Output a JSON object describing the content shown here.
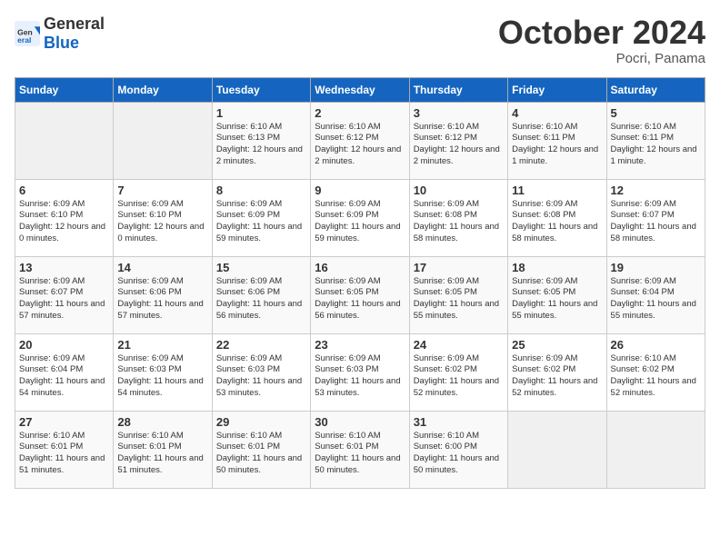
{
  "header": {
    "logo_general": "General",
    "logo_blue": "Blue",
    "month": "October 2024",
    "location": "Pocri, Panama"
  },
  "weekdays": [
    "Sunday",
    "Monday",
    "Tuesday",
    "Wednesday",
    "Thursday",
    "Friday",
    "Saturday"
  ],
  "weeks": [
    [
      {
        "day": "",
        "empty": true
      },
      {
        "day": "",
        "empty": true
      },
      {
        "day": "1",
        "sunrise": "Sunrise: 6:10 AM",
        "sunset": "Sunset: 6:13 PM",
        "daylight": "Daylight: 12 hours and 2 minutes."
      },
      {
        "day": "2",
        "sunrise": "Sunrise: 6:10 AM",
        "sunset": "Sunset: 6:12 PM",
        "daylight": "Daylight: 12 hours and 2 minutes."
      },
      {
        "day": "3",
        "sunrise": "Sunrise: 6:10 AM",
        "sunset": "Sunset: 6:12 PM",
        "daylight": "Daylight: 12 hours and 2 minutes."
      },
      {
        "day": "4",
        "sunrise": "Sunrise: 6:10 AM",
        "sunset": "Sunset: 6:11 PM",
        "daylight": "Daylight: 12 hours and 1 minute."
      },
      {
        "day": "5",
        "sunrise": "Sunrise: 6:10 AM",
        "sunset": "Sunset: 6:11 PM",
        "daylight": "Daylight: 12 hours and 1 minute."
      }
    ],
    [
      {
        "day": "6",
        "sunrise": "Sunrise: 6:09 AM",
        "sunset": "Sunset: 6:10 PM",
        "daylight": "Daylight: 12 hours and 0 minutes."
      },
      {
        "day": "7",
        "sunrise": "Sunrise: 6:09 AM",
        "sunset": "Sunset: 6:10 PM",
        "daylight": "Daylight: 12 hours and 0 minutes."
      },
      {
        "day": "8",
        "sunrise": "Sunrise: 6:09 AM",
        "sunset": "Sunset: 6:09 PM",
        "daylight": "Daylight: 11 hours and 59 minutes."
      },
      {
        "day": "9",
        "sunrise": "Sunrise: 6:09 AM",
        "sunset": "Sunset: 6:09 PM",
        "daylight": "Daylight: 11 hours and 59 minutes."
      },
      {
        "day": "10",
        "sunrise": "Sunrise: 6:09 AM",
        "sunset": "Sunset: 6:08 PM",
        "daylight": "Daylight: 11 hours and 58 minutes."
      },
      {
        "day": "11",
        "sunrise": "Sunrise: 6:09 AM",
        "sunset": "Sunset: 6:08 PM",
        "daylight": "Daylight: 11 hours and 58 minutes."
      },
      {
        "day": "12",
        "sunrise": "Sunrise: 6:09 AM",
        "sunset": "Sunset: 6:07 PM",
        "daylight": "Daylight: 11 hours and 58 minutes."
      }
    ],
    [
      {
        "day": "13",
        "sunrise": "Sunrise: 6:09 AM",
        "sunset": "Sunset: 6:07 PM",
        "daylight": "Daylight: 11 hours and 57 minutes."
      },
      {
        "day": "14",
        "sunrise": "Sunrise: 6:09 AM",
        "sunset": "Sunset: 6:06 PM",
        "daylight": "Daylight: 11 hours and 57 minutes."
      },
      {
        "day": "15",
        "sunrise": "Sunrise: 6:09 AM",
        "sunset": "Sunset: 6:06 PM",
        "daylight": "Daylight: 11 hours and 56 minutes."
      },
      {
        "day": "16",
        "sunrise": "Sunrise: 6:09 AM",
        "sunset": "Sunset: 6:05 PM",
        "daylight": "Daylight: 11 hours and 56 minutes."
      },
      {
        "day": "17",
        "sunrise": "Sunrise: 6:09 AM",
        "sunset": "Sunset: 6:05 PM",
        "daylight": "Daylight: 11 hours and 55 minutes."
      },
      {
        "day": "18",
        "sunrise": "Sunrise: 6:09 AM",
        "sunset": "Sunset: 6:05 PM",
        "daylight": "Daylight: 11 hours and 55 minutes."
      },
      {
        "day": "19",
        "sunrise": "Sunrise: 6:09 AM",
        "sunset": "Sunset: 6:04 PM",
        "daylight": "Daylight: 11 hours and 55 minutes."
      }
    ],
    [
      {
        "day": "20",
        "sunrise": "Sunrise: 6:09 AM",
        "sunset": "Sunset: 6:04 PM",
        "daylight": "Daylight: 11 hours and 54 minutes."
      },
      {
        "day": "21",
        "sunrise": "Sunrise: 6:09 AM",
        "sunset": "Sunset: 6:03 PM",
        "daylight": "Daylight: 11 hours and 54 minutes."
      },
      {
        "day": "22",
        "sunrise": "Sunrise: 6:09 AM",
        "sunset": "Sunset: 6:03 PM",
        "daylight": "Daylight: 11 hours and 53 minutes."
      },
      {
        "day": "23",
        "sunrise": "Sunrise: 6:09 AM",
        "sunset": "Sunset: 6:03 PM",
        "daylight": "Daylight: 11 hours and 53 minutes."
      },
      {
        "day": "24",
        "sunrise": "Sunrise: 6:09 AM",
        "sunset": "Sunset: 6:02 PM",
        "daylight": "Daylight: 11 hours and 52 minutes."
      },
      {
        "day": "25",
        "sunrise": "Sunrise: 6:09 AM",
        "sunset": "Sunset: 6:02 PM",
        "daylight": "Daylight: 11 hours and 52 minutes."
      },
      {
        "day": "26",
        "sunrise": "Sunrise: 6:10 AM",
        "sunset": "Sunset: 6:02 PM",
        "daylight": "Daylight: 11 hours and 52 minutes."
      }
    ],
    [
      {
        "day": "27",
        "sunrise": "Sunrise: 6:10 AM",
        "sunset": "Sunset: 6:01 PM",
        "daylight": "Daylight: 11 hours and 51 minutes."
      },
      {
        "day": "28",
        "sunrise": "Sunrise: 6:10 AM",
        "sunset": "Sunset: 6:01 PM",
        "daylight": "Daylight: 11 hours and 51 minutes."
      },
      {
        "day": "29",
        "sunrise": "Sunrise: 6:10 AM",
        "sunset": "Sunset: 6:01 PM",
        "daylight": "Daylight: 11 hours and 50 minutes."
      },
      {
        "day": "30",
        "sunrise": "Sunrise: 6:10 AM",
        "sunset": "Sunset: 6:01 PM",
        "daylight": "Daylight: 11 hours and 50 minutes."
      },
      {
        "day": "31",
        "sunrise": "Sunrise: 6:10 AM",
        "sunset": "Sunset: 6:00 PM",
        "daylight": "Daylight: 11 hours and 50 minutes."
      },
      {
        "day": "",
        "empty": true
      },
      {
        "day": "",
        "empty": true
      }
    ]
  ]
}
